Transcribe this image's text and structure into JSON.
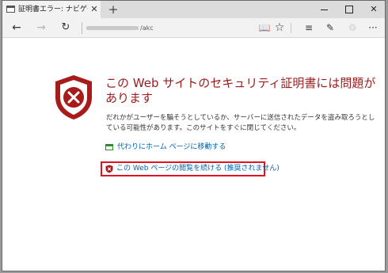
{
  "tab": {
    "title": "証明書エラー: ナビゲーション",
    "close_label": "✕",
    "new_tab_label": "+"
  },
  "window": {
    "minimize_icon": "minimize-icon",
    "maximize_icon": "maximize-icon",
    "close_label": "✕"
  },
  "navbar": {
    "back_label": "←",
    "forward_label": "→",
    "refresh_label": "↻",
    "address_suffix": "/akc",
    "reading_label": "📖",
    "favorite_label": "☆",
    "hub_label": "≡",
    "note_label": "✎",
    "share_label": "♲",
    "more_label": "···"
  },
  "content": {
    "heading": "この Web サイトのセキュリティ証明書には問題があります",
    "description": "だれかがユーザーを騙そうとしているか、サーバーに送信されたデータを盗み取ろうとしている可能性があります。このサイトをすぐに閉じてください。",
    "home_link": "代わりにホーム ページに移動する",
    "continue_link": "この Web ページの閲覧を続ける (推奨されません)"
  },
  "colors": {
    "shield_red": "#a81b1b",
    "heading_red": "#9b1b1b",
    "link_blue": "#0063b1",
    "highlight_red": "#e0141e"
  }
}
